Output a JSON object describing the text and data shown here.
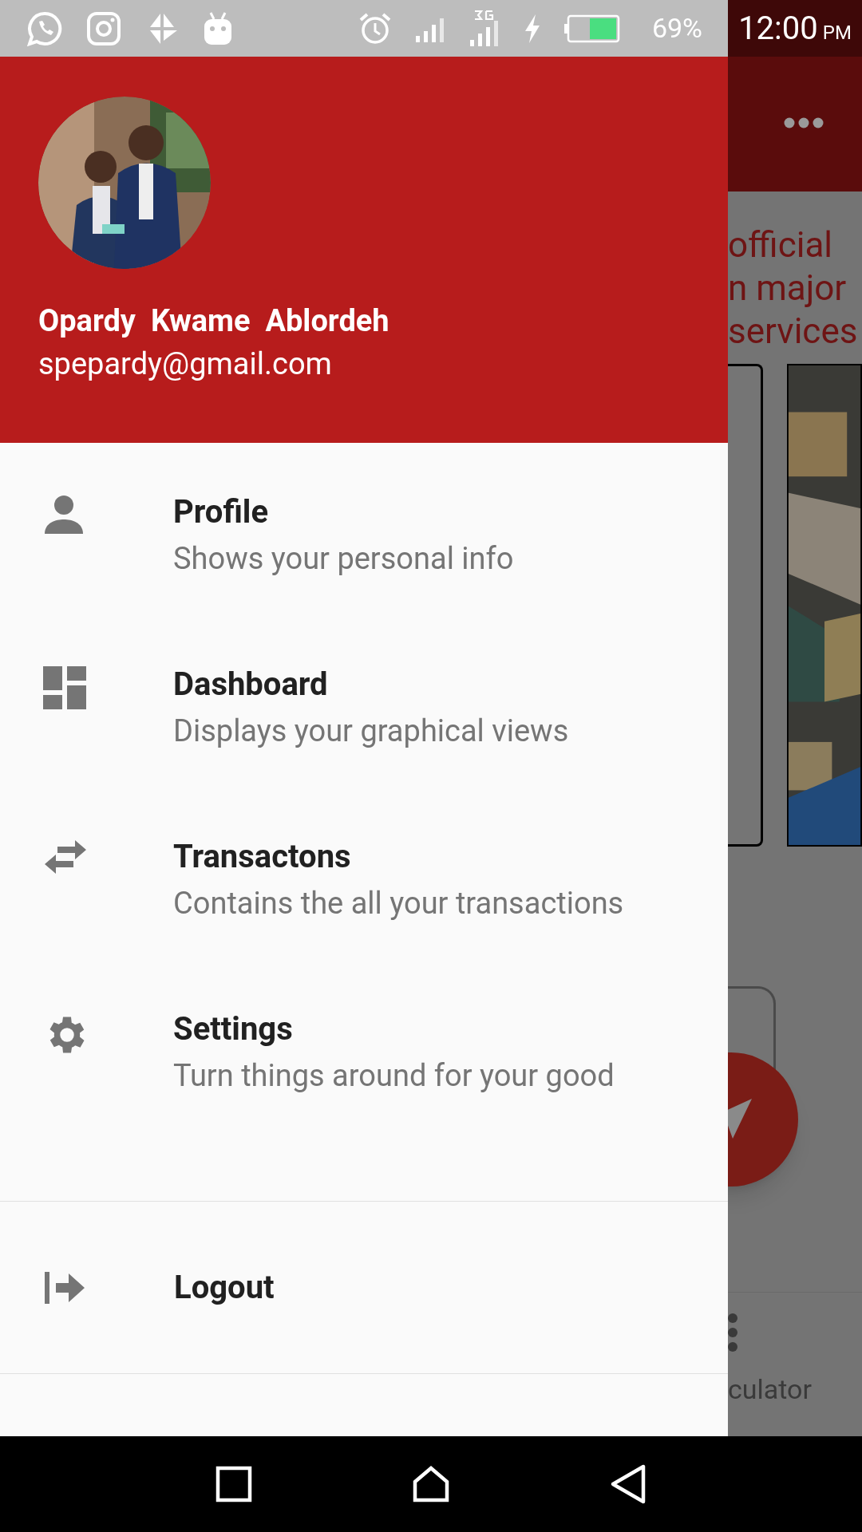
{
  "status_bar": {
    "battery_percent": "69%",
    "time": "12:00",
    "time_suffix": "PM"
  },
  "drawer": {
    "header": {
      "name": "Opardy  Kwame  Ablordeh",
      "email": "spepardy@gmail.com"
    },
    "items": [
      {
        "title": "Profile",
        "subtitle": "Shows your personal info"
      },
      {
        "title": "Dashboard",
        "subtitle": "Displays your graphical views"
      },
      {
        "title": "Transactons",
        "subtitle": "Contains the all your transactions"
      },
      {
        "title": "Settings",
        "subtitle": "Turn things around for your good"
      }
    ],
    "logout": {
      "label": "Logout"
    }
  },
  "background_screen": {
    "headline_lines": [
      "official",
      "n major",
      "services"
    ],
    "bottom_tab_label": "culator"
  }
}
